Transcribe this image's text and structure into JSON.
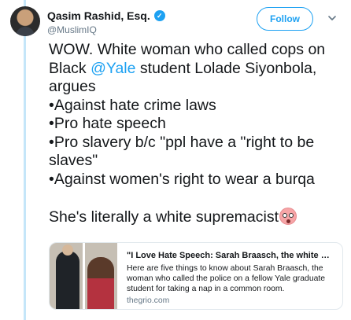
{
  "author": {
    "display_name": "Qasim Rashid, Esq.",
    "handle": "@MuslimIQ",
    "verified_badge": "✓"
  },
  "actions": {
    "follow_label": "Follow",
    "more_icon": "chevron-down-icon"
  },
  "tweet": {
    "line1": "WOW. White woman who called cops on",
    "line2_pre": "Black ",
    "line2_mention": "@Yale",
    "line2_post": " student Lolade Siyonbola,",
    "line3": "argues",
    "line4": "•Against hate crime laws",
    "line5": "•Pro hate speech",
    "line6": "•Pro slavery b/c \"ppl have a \"right to be",
    "line7": "slaves\"",
    "line8": "•Against women's right to wear a burqa",
    "line9": "She's literally a white supremacist",
    "emoji": "flushed-face-emoji"
  },
  "link_card": {
    "title": "\"I Love Hate Speech: Sarah Braasch, the white wo...",
    "description": "Here are five things to know about Sarah Braasch, the woman who called the police on a fellow Yale graduate student for taking a nap in a common room.",
    "domain": "thegrio.com"
  },
  "colors": {
    "accent": "#1da1f2",
    "text": "#14171a",
    "muted": "#657786",
    "thread_rule": "#c5e6f9"
  }
}
